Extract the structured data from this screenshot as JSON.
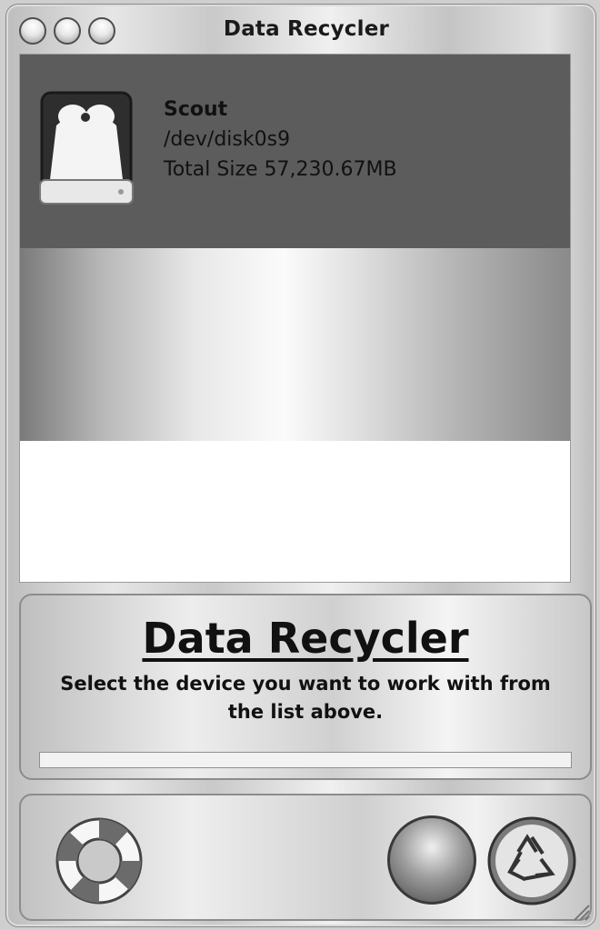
{
  "window": {
    "title": "Data Recycler"
  },
  "device": {
    "name": "Scout",
    "path": "/dev/disk0s9",
    "total_size": "Total Size 57,230.67MB"
  },
  "info": {
    "title": "Data Recycler",
    "message": "Select the device you want to work with from the list above.",
    "progress": 0
  },
  "buttons": {
    "help_icon": "lifebuoy-icon",
    "start_icon": "round-button-icon",
    "recycle_icon": "recycle-icon"
  }
}
